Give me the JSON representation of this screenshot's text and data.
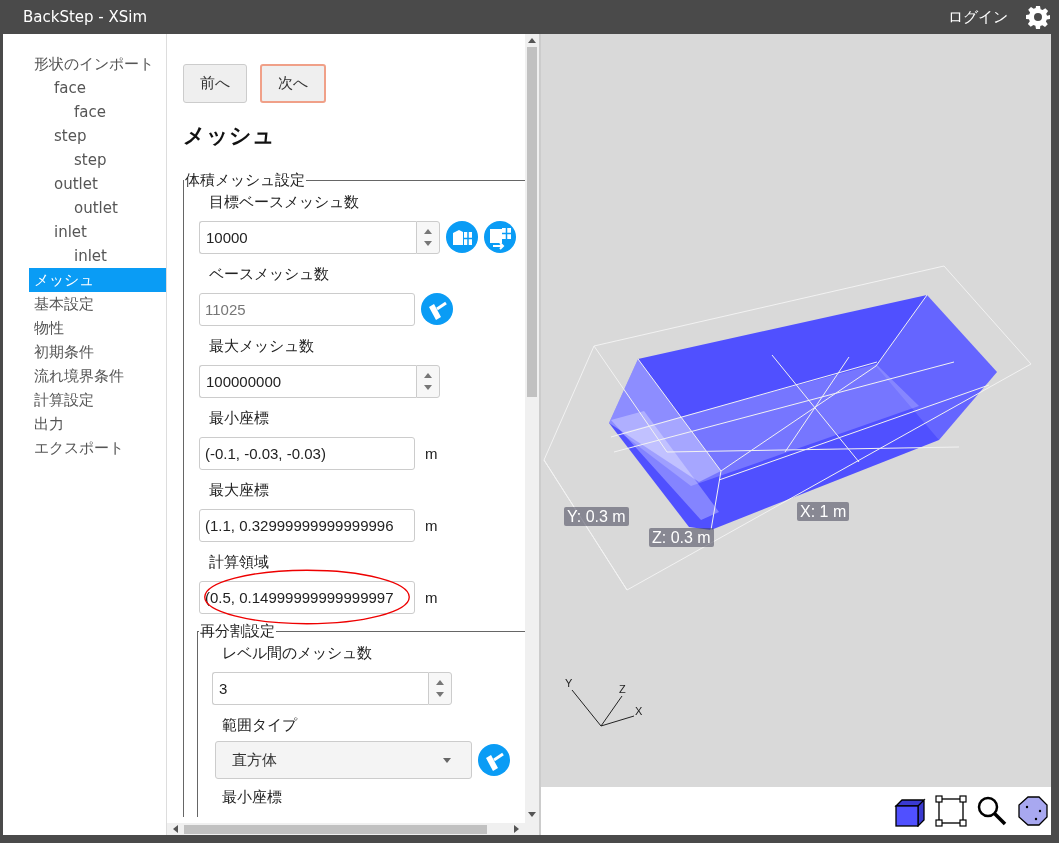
{
  "window": {
    "title": "BackStep - XSim",
    "login": "ログイン"
  },
  "sidebar": {
    "items": [
      {
        "label": "形状のインポート",
        "selected": false,
        "children": [
          {
            "label": "face",
            "selected": false,
            "children": [
              {
                "label": "face",
                "selected": false
              }
            ]
          },
          {
            "label": "step",
            "selected": false,
            "children": [
              {
                "label": "step",
                "selected": false
              }
            ]
          },
          {
            "label": "outlet",
            "selected": false,
            "children": [
              {
                "label": "outlet",
                "selected": false
              }
            ]
          },
          {
            "label": "inlet",
            "selected": false,
            "children": [
              {
                "label": "inlet",
                "selected": false
              }
            ]
          }
        ]
      },
      {
        "label": "メッシュ",
        "selected": true
      },
      {
        "label": "基本設定",
        "selected": false
      },
      {
        "label": "物性",
        "selected": false
      },
      {
        "label": "初期条件",
        "selected": false
      },
      {
        "label": "流れ境界条件",
        "selected": false
      },
      {
        "label": "計算設定",
        "selected": false
      },
      {
        "label": "出力",
        "selected": false
      },
      {
        "label": "エクスポート",
        "selected": false
      }
    ]
  },
  "nav_buttons": [
    {
      "label": "前へ",
      "focused": false
    },
    {
      "label": "次へ",
      "focused": true
    }
  ],
  "heading": "メッシュ",
  "volume_mesh": {
    "legend": "体積メッシュ設定",
    "fields": [
      {
        "kind": "spinner",
        "label": "目標ベースメッシュ数",
        "value": "10000",
        "tools": [
          {
            "kind": "grid-in"
          },
          {
            "kind": "grid-out"
          }
        ]
      },
      {
        "kind": "readonly",
        "label": "ベースメッシュ数",
        "value": "11025",
        "tools": [
          {
            "kind": "roller"
          }
        ]
      },
      {
        "kind": "spinner",
        "label": "最大メッシュ数",
        "value": "100000000"
      },
      {
        "kind": "text",
        "label": "最小座標",
        "value": "(-0.1, -0.03, -0.03)",
        "unit": "m"
      },
      {
        "kind": "text",
        "label": "最大座標",
        "value": "(1.1, 0.32999999999999996",
        "unit": "m"
      },
      {
        "kind": "text",
        "label": "計算領域",
        "value": "(0.5, 0.14999999999999997",
        "unit": "m",
        "circled": true
      }
    ]
  },
  "refinement": {
    "legend": "再分割設定",
    "fields": [
      {
        "kind": "spinner",
        "label": "レベル間のメッシュ数",
        "value": "3"
      },
      {
        "kind": "select",
        "label": "範囲タイプ",
        "value": "直方体",
        "tools": [
          {
            "kind": "roller"
          }
        ]
      },
      {
        "kind": "label",
        "label": "最小座標"
      }
    ]
  },
  "viewer": {
    "dimension_labels": [
      "Y: 0.3 m",
      "Z: 0.3 m",
      "X: 1 m"
    ],
    "axes": [
      "Y",
      "Z",
      "X"
    ]
  }
}
